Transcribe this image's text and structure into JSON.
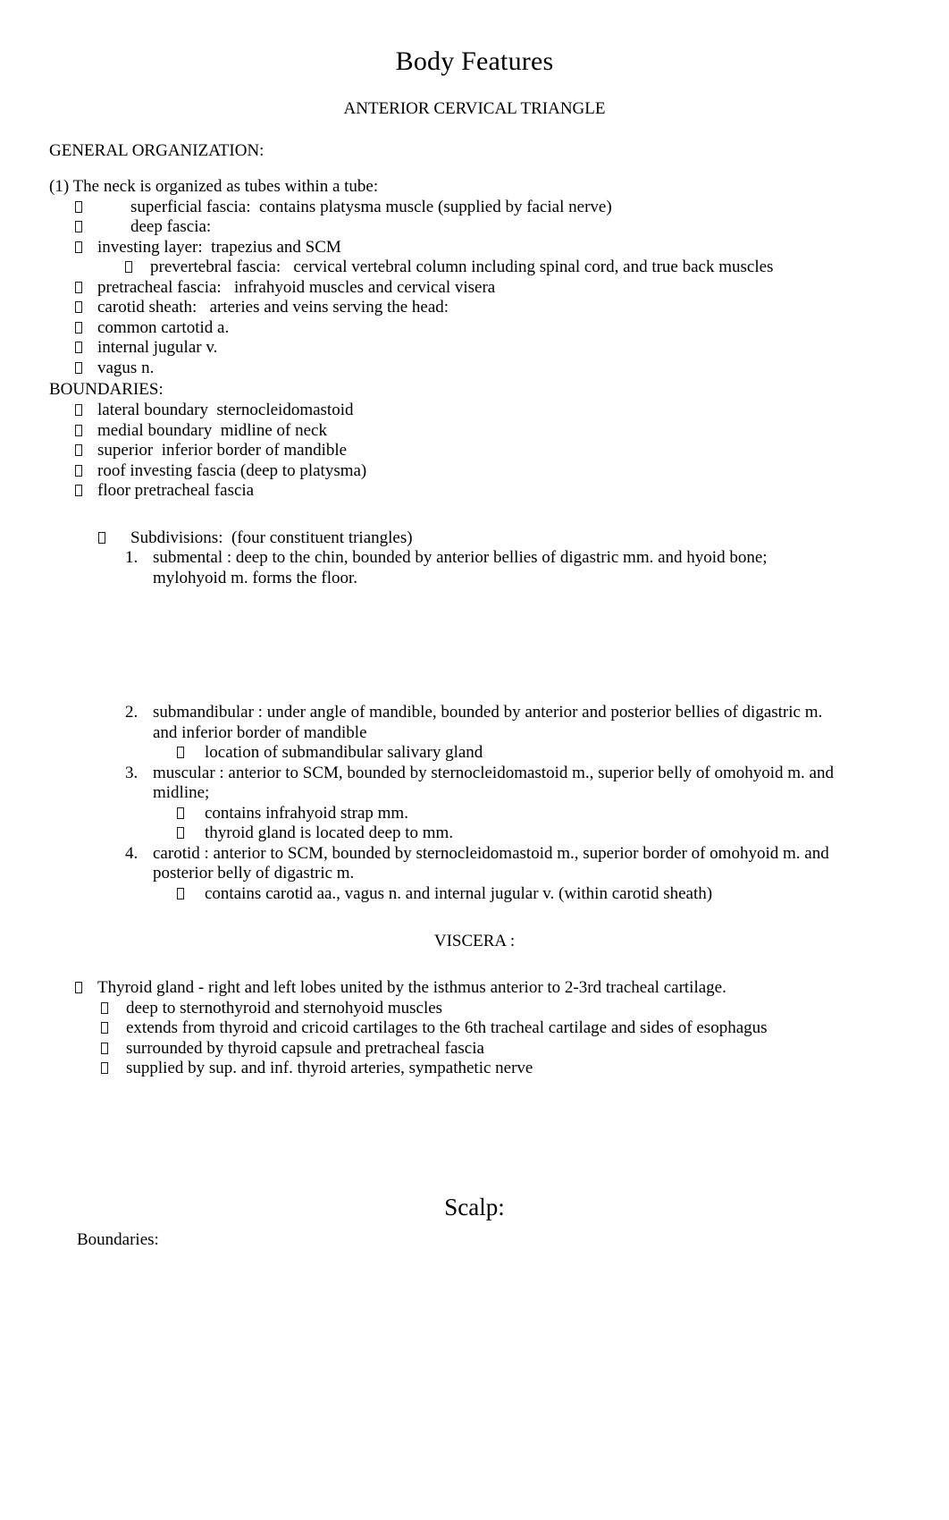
{
  "document": {
    "title": "Body Features",
    "subtitle": "ANTERIOR CERVICAL TRIANGLE",
    "bullet_glyph": "tofu-box"
  },
  "general_organization": {
    "heading": "GENERAL ORGANIZATION:",
    "intro": "(1) The neck is organized as tubes within a tube:",
    "items": [
      {
        "text": "superficial fascia:  contains platysma muscle (supplied by facial nerve)",
        "level": "a"
      },
      {
        "text": "deep fascia:",
        "level": "a"
      },
      {
        "text": "investing layer:  trapezius and SCM",
        "level": "b"
      },
      {
        "text": "prevertebral fascia:   cervical vertebral column including spinal cord, and true back muscles",
        "level": "c"
      },
      {
        "text": "pretracheal fascia:   infrahyoid muscles and cervical visera",
        "level": "b"
      },
      {
        "text": "carotid sheath:   arteries and veins serving the head:",
        "level": "b"
      },
      {
        "text": "common cartotid a.",
        "level": "b"
      },
      {
        "text": "internal jugular v.",
        "level": "b"
      },
      {
        "text": "vagus n.",
        "level": "b"
      }
    ]
  },
  "boundaries": {
    "heading": "BOUNDARIES:",
    "items": [
      "lateral boundary  sternocleidomastoid",
      "medial boundary  midline of neck",
      "superior  inferior border of mandible",
      "roof investing fascia (deep to platysma)",
      "floor pretracheal fascia"
    ]
  },
  "subdivisions": {
    "heading": "Subdivisions:  (four constituent triangles)",
    "items": [
      {
        "number": "1.",
        "text": "submental : deep to the chin, bounded by anterior bellies of digastric mm. and hyoid bone; mylohyoid m. forms the floor.",
        "subitems": []
      },
      {
        "number": "2.",
        "text": "submandibular  : under angle of mandible, bounded by anterior and posterior bellies of digastric m. and inferior border of mandible",
        "subitems": [
          "location of submandibular salivary gland"
        ]
      },
      {
        "number": "3.",
        "text": "muscular : anterior to SCM, bounded by sternocleidomastoid m., superior belly of omohyoid m. and midline;",
        "subitems": [
          "contains infrahyoid strap mm.",
          "thyroid gland is located deep to mm."
        ]
      },
      {
        "number": "4.",
        "text": "carotid : anterior to SCM, bounded by sternocleidomastoid m., superior border of omohyoid m. and posterior belly of digastric m.",
        "subitems": [
          "contains carotid aa., vagus n. and internal jugular v. (within carotid sheath)"
        ]
      }
    ]
  },
  "viscera": {
    "heading": "VISCERA :",
    "main_item": "Thyroid gland   - right and left lobes united by the isthmus anterior to 2-3rd tracheal cartilage.",
    "subitems": [
      "deep to sternothyroid and sternohyoid muscles",
      "extends from thyroid and cricoid cartilages to the 6th tracheal cartilage and sides of esophagus",
      "surrounded by thyroid capsule and pretracheal fascia",
      "supplied by sup. and inf. thyroid arteries, sympathetic nerve"
    ]
  },
  "scalp": {
    "heading": "Scalp:",
    "boundaries_label": "Boundaries:"
  }
}
